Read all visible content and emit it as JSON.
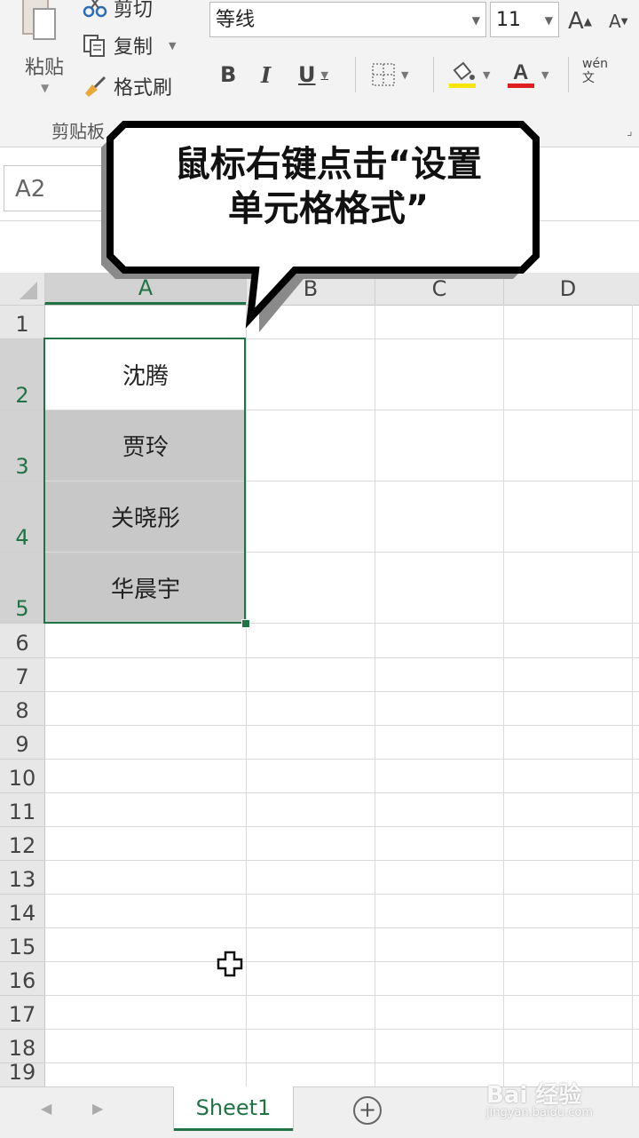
{
  "ribbon": {
    "paste_label": "粘贴",
    "cut_label": "剪切",
    "copy_label": "复制",
    "format_painter_label": "格式刷",
    "clipboard_group_label": "剪贴板",
    "font_name": "等线",
    "font_size": "11",
    "bold": "B",
    "italic": "I",
    "underline": "U",
    "grow_font": "A",
    "shrink_font": "A",
    "phonetic": "wén\n文",
    "accent_color": "#217346",
    "highlight_color": "#f7e600",
    "font_color": "#e02020"
  },
  "formula_bar": {
    "name_box": "A2"
  },
  "columns": [
    "A",
    "B",
    "C",
    "D"
  ],
  "rows": [
    "1",
    "2",
    "3",
    "4",
    "5",
    "6",
    "7",
    "8",
    "9",
    "10",
    "11",
    "12",
    "13",
    "14",
    "15",
    "16",
    "17",
    "18",
    "19"
  ],
  "cells": {
    "A2": "沈腾",
    "A3": "贾玲",
    "A4": "关晓彤",
    "A5": "华晨宇"
  },
  "callout": {
    "line1": "鼠标右键点击“设置",
    "line2": "单元格格式”"
  },
  "sheet_tabs": {
    "active": "Sheet1",
    "add_icon": "plus-circle-icon"
  },
  "watermark": {
    "logo": "Bai 经验",
    "url": "jingyan.baidu.com"
  }
}
